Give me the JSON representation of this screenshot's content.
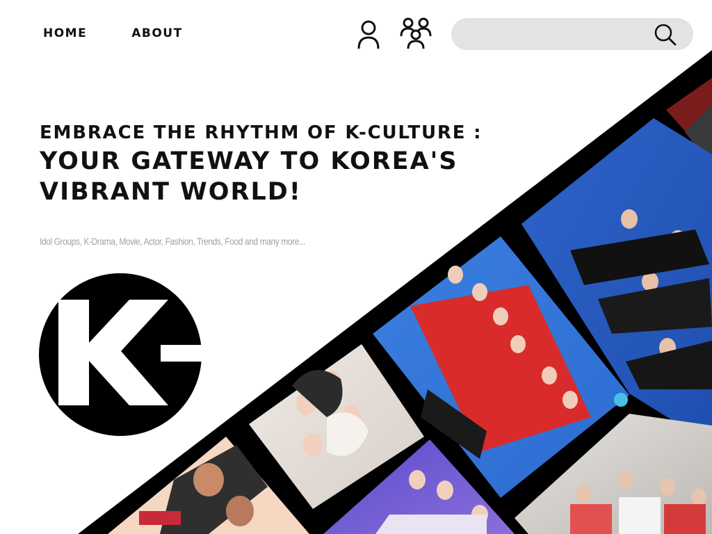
{
  "nav": {
    "home_label": "HOME",
    "about_label": "ABOUT",
    "user_icon": "user-icon",
    "group_icon": "group-icon"
  },
  "search": {
    "placeholder": "",
    "value": "",
    "icon": "search-icon"
  },
  "hero": {
    "headline_line1": "EMBRACE THE RHYTHM OF K-CULTURE :",
    "headline_line2": "YOUR GATEWAY TO KOREA'S VIBRANT WORLD!",
    "tagline": "Idol Groups, K-Drama, Movie, Actor, Fashion, Trends, Food and many more..."
  },
  "logo": {
    "alt": "K- logo",
    "lettering": "K-"
  },
  "collage": {
    "photos": [
      "group-photo-black-outfits",
      "girl-group-red-jackets",
      "girl-group-white-outfits",
      "idol-closeup",
      "girl-group-purple",
      "boy-group-striped",
      "group-photo-top-corner"
    ]
  },
  "colors": {
    "text": "#111111",
    "tagline": "#a3a3a3",
    "search_bg": "#e3e3e3",
    "collage_bg": "#000000"
  }
}
